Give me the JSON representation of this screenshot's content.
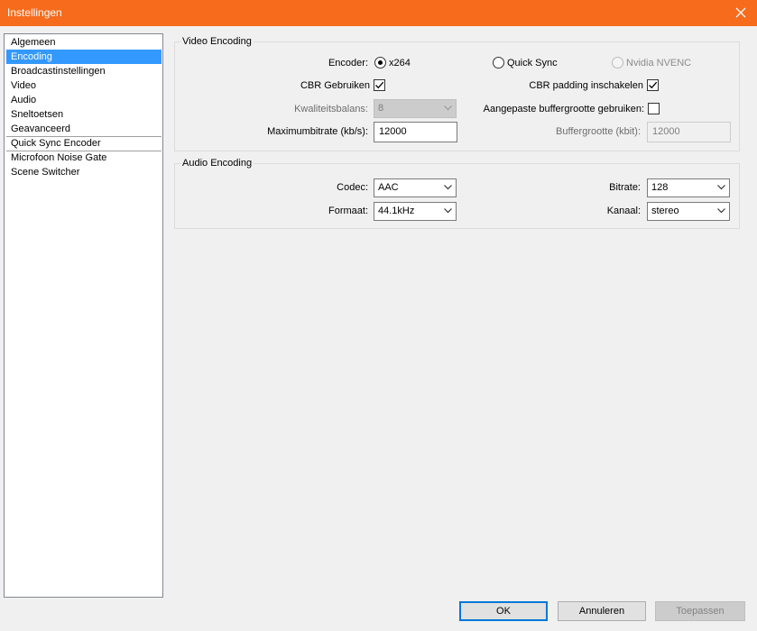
{
  "window": {
    "title": "Instellingen"
  },
  "sidebar": {
    "items": [
      {
        "label": "Algemeen"
      },
      {
        "label": "Encoding"
      },
      {
        "label": "Broadcastinstellingen"
      },
      {
        "label": "Video"
      },
      {
        "label": "Audio"
      },
      {
        "label": "Sneltoetsen"
      },
      {
        "label": "Geavanceerd"
      },
      {
        "label": "Quick Sync Encoder"
      },
      {
        "label": "Microfoon Noise Gate"
      },
      {
        "label": "Scene Switcher"
      }
    ],
    "selected": "Encoding"
  },
  "video": {
    "group_title": "Video Encoding",
    "encoder_label": "Encoder:",
    "encoder_options": [
      {
        "label": "x264",
        "checked": true,
        "enabled": true
      },
      {
        "label": "Quick Sync",
        "checked": false,
        "enabled": true
      },
      {
        "label": "Nvidia NVENC",
        "checked": false,
        "enabled": false
      }
    ],
    "cbr_label": "CBR Gebruiken",
    "cbr_checked": true,
    "cbr_padding_label": "CBR padding inschakelen",
    "cbr_padding_checked": true,
    "quality_label": "Kwaliteitsbalans:",
    "quality_value": "8",
    "custom_buffer_label": "Aangepaste buffergrootte gebruiken:",
    "custom_buffer_checked": false,
    "max_bitrate_label": "Maximumbitrate (kb/s):",
    "max_bitrate_value": "12000",
    "buffer_size_label": "Buffergrootte (kbit):",
    "buffer_size_value": "12000"
  },
  "audio": {
    "group_title": "Audio Encoding",
    "codec_label": "Codec:",
    "codec_value": "AAC",
    "format_label": "Formaat:",
    "format_value": "44.1kHz",
    "bitrate_label": "Bitrate:",
    "bitrate_value": "128",
    "channel_label": "Kanaal:",
    "channel_value": "stereo"
  },
  "buttons": {
    "ok": "OK",
    "cancel": "Annuleren",
    "apply": "Toepassen"
  },
  "colors": {
    "titlebar": "#f76b1c",
    "selection": "#3399ff",
    "default_button_border": "#0078d7"
  }
}
